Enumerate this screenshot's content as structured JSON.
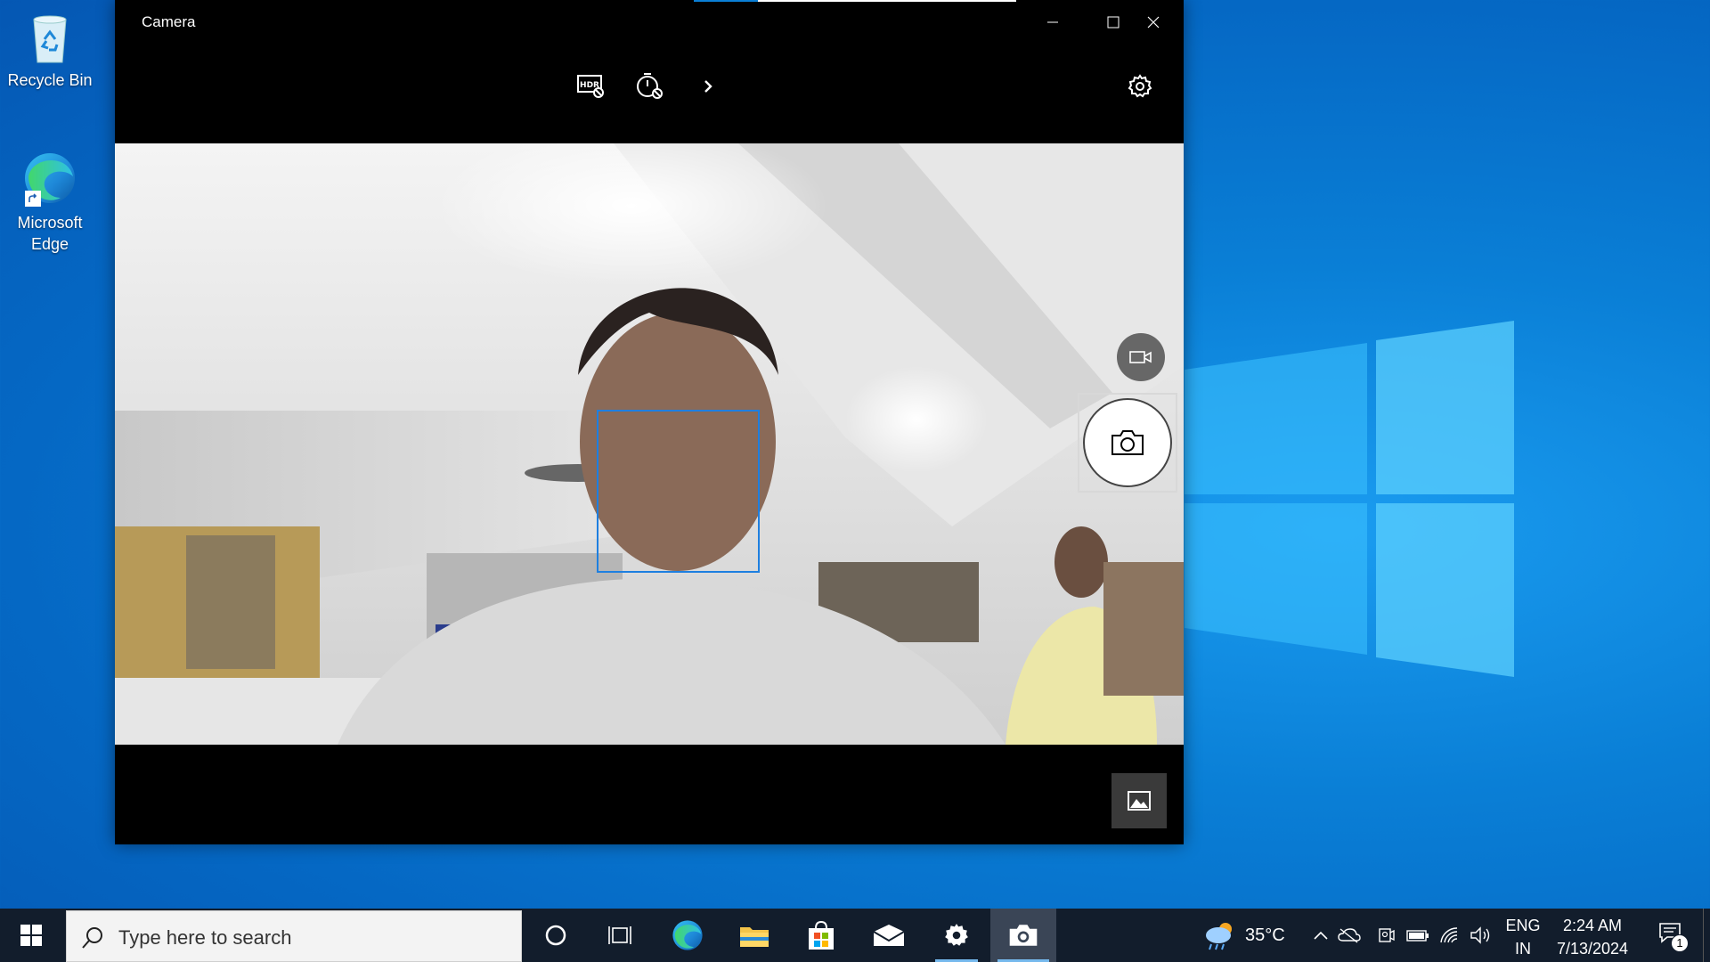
{
  "desktop": {
    "icons": [
      {
        "label": "Recycle Bin"
      },
      {
        "label": "Microsoft Edge"
      }
    ]
  },
  "camera_window": {
    "title": "Camera",
    "toolbar": {
      "hdr_icon": "hdr-off-icon",
      "timer_icon": "timer-off-icon",
      "expand_icon": "chevron-right-icon",
      "settings_icon": "gear-icon"
    },
    "controls": {
      "video_mode_icon": "video-camera-icon",
      "photo_icon": "camera-icon",
      "gallery_icon": "photo-gallery-icon"
    }
  },
  "taskbar": {
    "search_placeholder": "Type here to search",
    "weather": {
      "temperature": "35°C",
      "icon": "partly-cloudy-rain-icon"
    },
    "language": {
      "line1": "ENG",
      "line2": "IN"
    },
    "clock": {
      "time": "2:24 AM",
      "date": "7/13/2024"
    },
    "notification_count": "1",
    "apps": [
      "cortana",
      "task-view",
      "edge",
      "file-explorer",
      "microsoft-store",
      "mail",
      "settings",
      "camera"
    ]
  },
  "colors": {
    "desktop_blue": "#0a7fd6",
    "taskbar": "#121d2c",
    "face_detect": "#1e7fe0"
  }
}
